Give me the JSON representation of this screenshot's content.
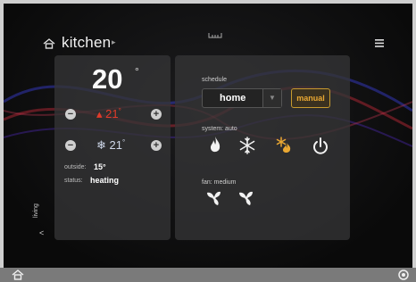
{
  "header": {
    "room": "kitchen",
    "room_arrow": "▸"
  },
  "thermostat": {
    "current_temp": "20",
    "degree_symbol": "°",
    "heat_setpoint": "21",
    "cool_setpoint": "21",
    "minus": "−",
    "plus": "+",
    "heat_glyph": "▴",
    "cool_glyph": "❄"
  },
  "info": {
    "outside_label": "outside:",
    "outside_value": "15°",
    "status_label": "status:",
    "status_value": "heating"
  },
  "side_nav": {
    "label": "living",
    "arrow": "<"
  },
  "schedule": {
    "label": "schedule",
    "selected": "home",
    "caret": "▼",
    "manual_label": "manual"
  },
  "system": {
    "label": "system: auto",
    "modes": [
      "heat",
      "cool",
      "auto",
      "off"
    ],
    "active_mode": "auto"
  },
  "fan": {
    "label": "fan: medium",
    "modes": [
      "auto",
      "on"
    ]
  },
  "colors": {
    "heat": "#e23b2a",
    "accent": "#eaa832",
    "panel": "#343436",
    "icon": "#f2f2f2"
  }
}
